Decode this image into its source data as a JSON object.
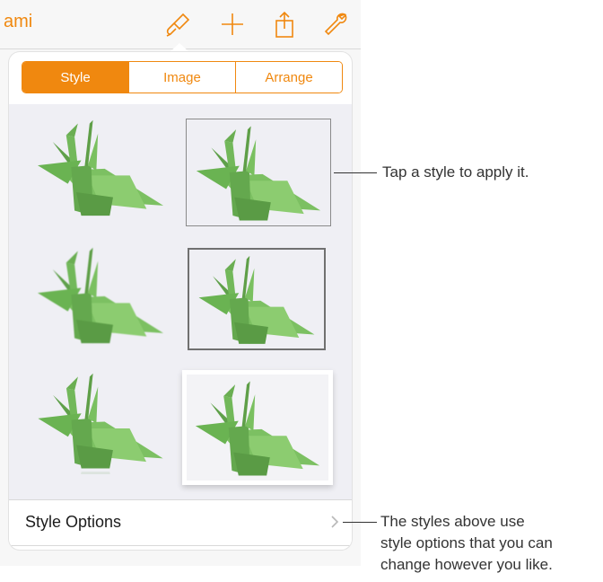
{
  "toolbar": {
    "doc_title": "ami",
    "icons": [
      "paintbrush-icon",
      "plus-icon",
      "share-icon",
      "wrench-icon"
    ],
    "accent_color": "#f0880f"
  },
  "tabs": [
    {
      "label": "Style",
      "active": true
    },
    {
      "label": "Image",
      "active": false
    },
    {
      "label": "Arrange",
      "active": false
    }
  ],
  "styles": [
    {
      "name": "style-1"
    },
    {
      "name": "style-2"
    },
    {
      "name": "style-3"
    },
    {
      "name": "style-4"
    },
    {
      "name": "style-5"
    },
    {
      "name": "style-6"
    }
  ],
  "options_row": {
    "label": "Style Options"
  },
  "callouts": {
    "top": "Tap a style to apply it.",
    "bottom_lines": [
      "The styles above use",
      "style options that you can",
      "change however you like."
    ]
  }
}
